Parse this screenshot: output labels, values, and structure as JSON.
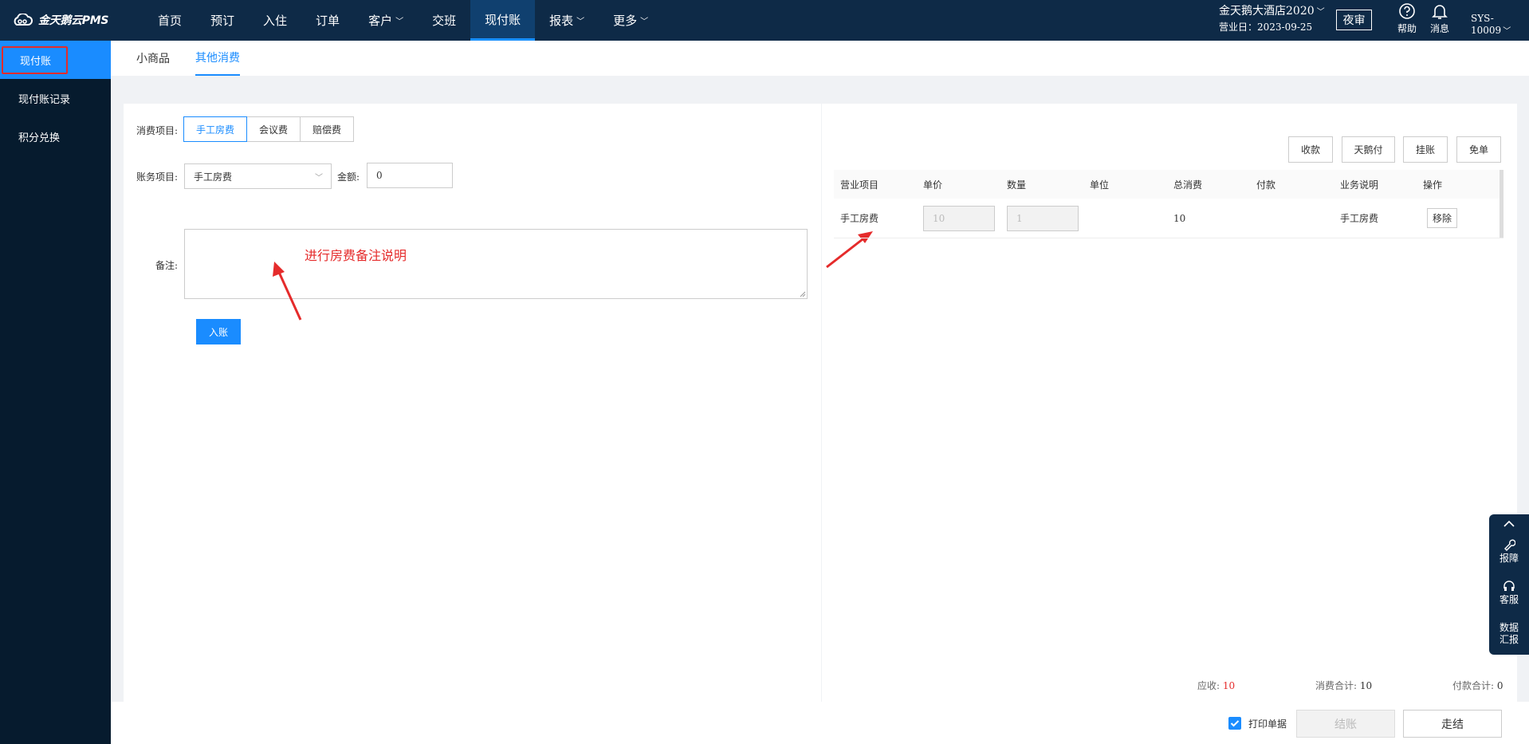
{
  "brand": {
    "logo_text": "金天鹅云PMS"
  },
  "nav": {
    "items": [
      {
        "label": "首页",
        "has_menu": false,
        "active": false
      },
      {
        "label": "预订",
        "has_menu": false,
        "active": false
      },
      {
        "label": "入住",
        "has_menu": false,
        "active": false
      },
      {
        "label": "订单",
        "has_menu": false,
        "active": false
      },
      {
        "label": "客户",
        "has_menu": true,
        "active": false
      },
      {
        "label": "交班",
        "has_menu": false,
        "active": false
      },
      {
        "label": "现付账",
        "has_menu": false,
        "active": true
      },
      {
        "label": "报表",
        "has_menu": true,
        "active": false
      },
      {
        "label": "更多",
        "has_menu": true,
        "active": false
      }
    ]
  },
  "header": {
    "hotel_name": "金天鹅大酒店2020",
    "business_date": "营业日：2023-09-25",
    "night_audit": "夜审",
    "help": "帮助",
    "messages": "消息",
    "user": "SYS-10009"
  },
  "sidebar": {
    "items": [
      {
        "label": "现付账",
        "active": true
      },
      {
        "label": "现付账记录",
        "active": false
      },
      {
        "label": "积分兑换",
        "active": false
      }
    ]
  },
  "tabs": [
    {
      "label": "小商品",
      "active": false
    },
    {
      "label": "其他消费",
      "active": true
    }
  ],
  "form": {
    "consume_label": "消费项目:",
    "consume_options": [
      "手工房费",
      "会议费",
      "赔偿费"
    ],
    "consume_selected": "手工房费",
    "account_label": "账务项目:",
    "account_value": "手工房费",
    "amount_label": "金额:",
    "amount_value": "0",
    "remark_label": "备注:",
    "remark_annotation": "进行房费备注说明",
    "submit": "入账"
  },
  "actions": [
    "收款",
    "天鹅付",
    "挂账",
    "免单"
  ],
  "table": {
    "headers": [
      "营业项目",
      "单价",
      "数量",
      "单位",
      "总消费",
      "付款",
      "业务说明",
      "操作"
    ],
    "rows": [
      {
        "item": "手工房费",
        "price": "10",
        "qty": "1",
        "unit": "",
        "total": "10",
        "payment": "",
        "desc": "手工房费",
        "op": "移除"
      }
    ]
  },
  "totals": {
    "receivable_label": "应收:",
    "receivable": "10",
    "consume_label": "消费合计:",
    "consume": "10",
    "paid_label": "付款合计:",
    "paid": "0"
  },
  "footer": {
    "print_label": "打印单据",
    "print_checked": true,
    "settle": "结账",
    "walkout": "走结"
  },
  "float_bar": {
    "report_issue": "报障",
    "service": "客服",
    "data_report_1": "数据",
    "data_report_2": "汇报"
  },
  "colors": {
    "topbar": "#0e2a47",
    "sidebar": "#061b2e",
    "accent": "#1a8cff",
    "annotation": "#e52b2b"
  }
}
